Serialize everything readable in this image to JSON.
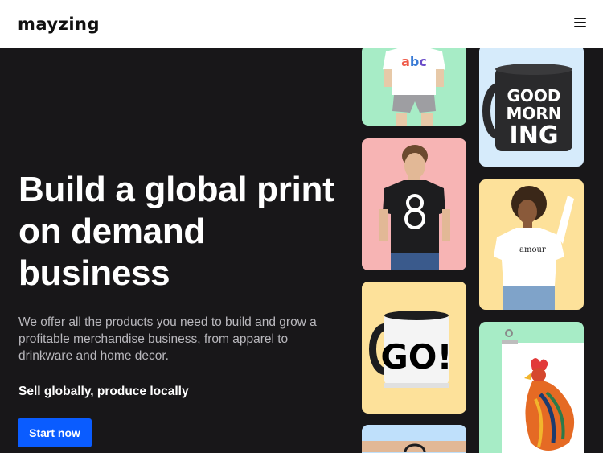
{
  "header": {
    "logo": "Mayzing",
    "menu_icon": "hamburger-menu-icon"
  },
  "hero": {
    "headline": "Build a global print on demand business",
    "subtext": "We offer all the products you need to build and grow a profitable merchandise business, from apparel to drinkware and home decor.",
    "tagline": "Sell globally, produce locally",
    "cta_label": "Start now"
  },
  "gallery": {
    "shirt_print": "abc",
    "mug_text": [
      "GOOD",
      "MORN",
      "ING"
    ],
    "sweater_text": "amour",
    "mug2_text": "GO!"
  },
  "colors": {
    "hero_bg": "#181719",
    "cta": "#0a5cff",
    "mint": "#a7ecc6",
    "pink": "#f7b4b4",
    "yellow": "#fde19a",
    "light_blue": "#d6ebfb"
  }
}
